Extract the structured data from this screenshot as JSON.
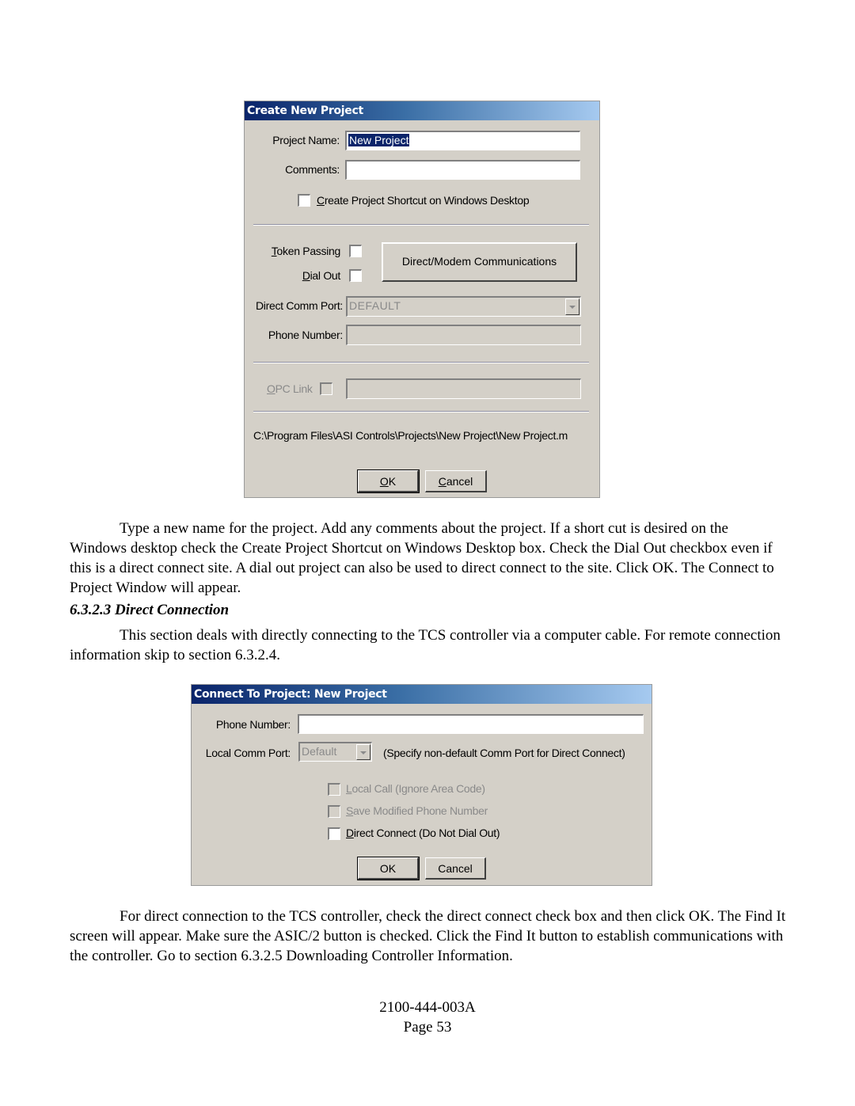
{
  "dialog1": {
    "title": "Create New Project",
    "project_name_label": "Project Name:",
    "project_name_value": "New Project",
    "comments_label": "Comments:",
    "comments_value": "",
    "shortcut_checkbox": {
      "accel": "C",
      "rest": "reate Project Shortcut on Windows Desktop",
      "checked": false
    },
    "token_passing": {
      "accel": "T",
      "rest": "oken Passing",
      "checked": false
    },
    "dial_out": {
      "accel": "D",
      "rest": "ial Out",
      "checked": false
    },
    "comm_button_label": "Direct/Modem Communications",
    "direct_comm_port_label": "Direct Comm Port:",
    "direct_comm_port_value": "DEFAULT",
    "phone_number_label": "Phone Number:",
    "phone_number_value": "",
    "opc_link": {
      "accel": "O",
      "rest": "PC Link",
      "checked": false
    },
    "opc_link_value": "",
    "path": "C:\\Program Files\\ASI Controls\\Projects\\New Project\\New Project.m",
    "ok": {
      "accel": "O",
      "rest": "K"
    },
    "cancel": {
      "accel": "C",
      "rest": "ancel"
    }
  },
  "dialog2": {
    "title": "Connect To Project:  New Project",
    "phone_number_label": "Phone Number:",
    "phone_number_value": "",
    "local_comm_port_label": "Local Comm Port:",
    "local_comm_port_value": "Default",
    "comm_port_hint": "(Specify non-default Comm Port for Direct Connect)",
    "local_call": {
      "accel": "L",
      "rest": "ocal Call (Ignore Area Code)",
      "checked": false
    },
    "save_phone": {
      "accel": "S",
      "rest": "ave Modified Phone Number",
      "checked": false
    },
    "direct_connect": {
      "accel": "D",
      "rest": "irect Connect (Do Not Dial Out)",
      "checked": false
    },
    "ok_label": "OK",
    "cancel_label": "Cancel"
  },
  "doc": {
    "para1": "Type a new name for the project. Add any comments about the project. If a short cut is desired on the Windows desktop check the Create Project Shortcut on Windows Desktop box. Check the Dial Out checkbox even if this is a direct connect site. A dial out project can also be used to direct connect to the site. Click OK. The Connect to Project Window will appear.",
    "heading": "6.3.2.3 Direct Connection",
    "para2": "This section deals with directly connecting to the TCS controller via a computer cable. For remote connection information skip to section 6.3.2.4.",
    "para3": "For direct connection to the TCS controller, check the direct connect check box and then click OK. The Find It screen will appear. Make sure the ASIC/2 button is checked. Click the Find It button to establish communications with the controller.  Go to section 6.3.2.5 Downloading Controller Information.",
    "doc_number": "2100-444-003A",
    "page": "Page 53"
  }
}
